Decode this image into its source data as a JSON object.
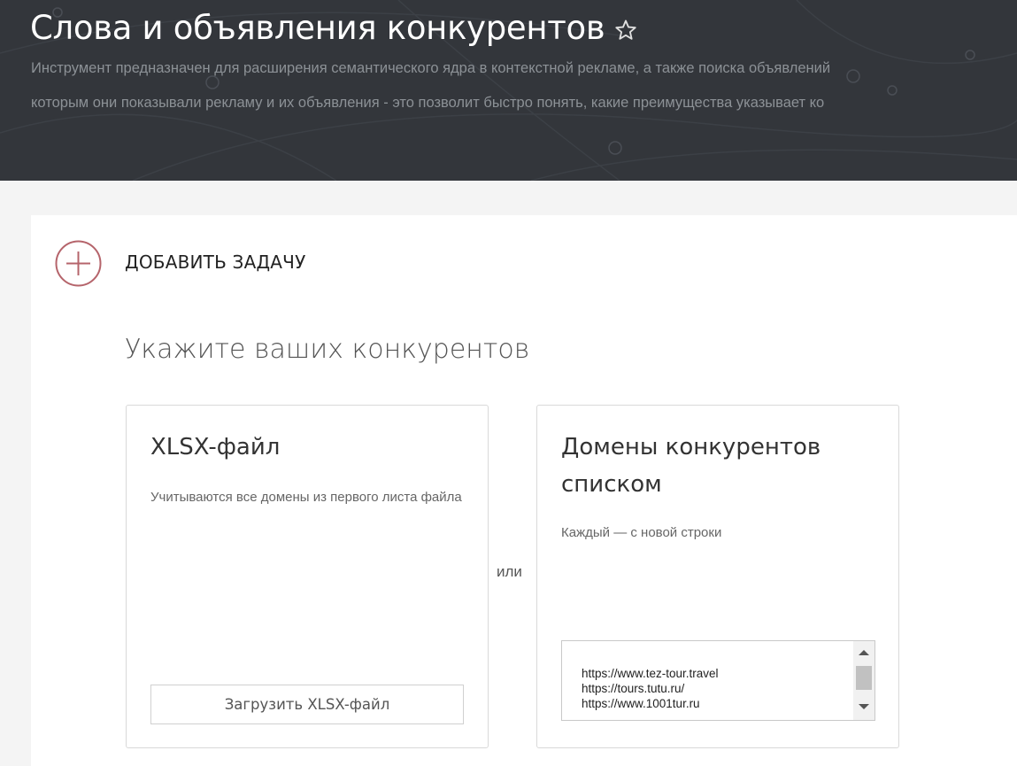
{
  "header": {
    "title": "Слова и объявления конкурентов",
    "description_line1": "Инструмент предназначен для расширения семантического ядра в контекстной рекламе, а также поиска объявлений",
    "description_line2": "которым они показывали рекламу и их объявления - это позволит быстро понять, какие преимущества указывает ко"
  },
  "task": {
    "add_label": "ДОБАВИТЬ ЗАДАЧУ",
    "section_title": "Укажите ваших конкурентов"
  },
  "xlsx": {
    "title": "XLSX-файл",
    "description": "Учитываются все домены из первого листа файла",
    "upload_label": "Загрузить XLSX-файл"
  },
  "or_label": "или",
  "domains": {
    "title": "Домены конкурентов списком",
    "description": "Каждый — с новой строки",
    "lines": [
      "https://www.tez-tour.travel",
      "https://tours.tutu.ru/",
      "https://www.1001tur.ru"
    ]
  },
  "colors": {
    "header_bg": "#33363b",
    "accent": "#b5646b"
  }
}
